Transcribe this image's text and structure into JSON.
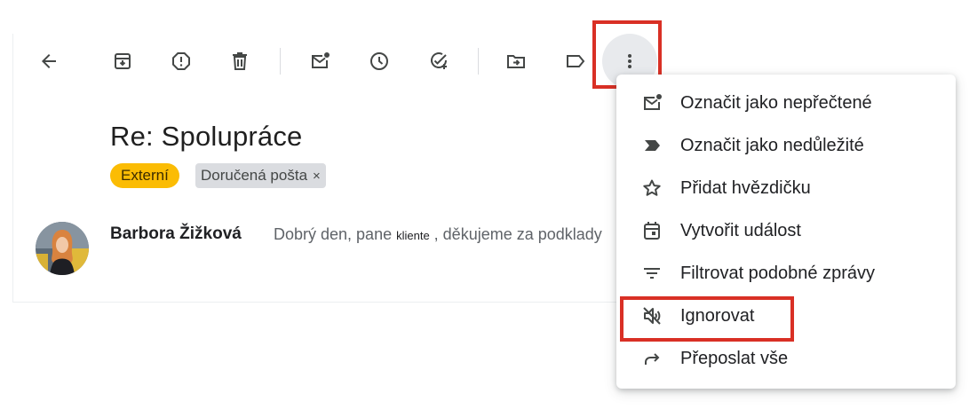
{
  "toolbar": {
    "icons": [
      "back-arrow-icon",
      "archive-icon",
      "report-spam-icon",
      "delete-icon",
      "mark-unread-icon",
      "snooze-icon",
      "add-task-icon",
      "move-to-icon",
      "label-icon",
      "more-vert-icon"
    ]
  },
  "email": {
    "subject": "Re: Spolupráce",
    "labels": {
      "externi": "Externí",
      "inbox": "Doručená pošta",
      "remove": "×"
    },
    "sender": "Barbora Žižková",
    "snippet_start": "Dobrý den, pane ",
    "snippet_small": "kliente",
    "snippet_end": " , děkujeme za podklady"
  },
  "menu": {
    "items": [
      {
        "label": "Označit jako nepřečtené",
        "icon": "mark-unread-icon"
      },
      {
        "label": "Označit jako nedůležité",
        "icon": "not-important-icon"
      },
      {
        "label": "Přidat hvězdičku",
        "icon": "star-icon"
      },
      {
        "label": "Vytvořit událost",
        "icon": "calendar-icon"
      },
      {
        "label": "Filtrovat podobné zprávy",
        "icon": "filter-icon"
      },
      {
        "label": "Ignorovat",
        "icon": "mute-icon"
      },
      {
        "label": "Přeposlat vše",
        "icon": "forward-icon"
      }
    ]
  },
  "colors": {
    "highlight": "#d93025",
    "label_externi": "#fbbc04",
    "label_inbox": "#dadce0"
  }
}
